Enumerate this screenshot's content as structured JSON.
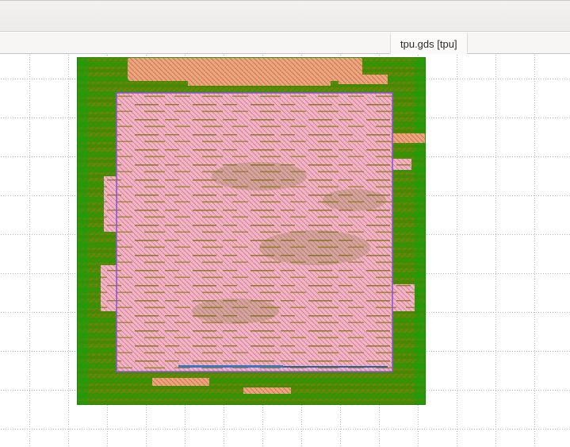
{
  "app": {
    "tab_label": "tpu.gds [tpu]"
  },
  "canvas": {
    "background": "#ffffff",
    "grid_color": "#b9b9b9",
    "die": {
      "colors": {
        "green_hatch": "#12a108",
        "olive_rows": "#7c7c08",
        "pink_region": "#f7b3c3",
        "pink_hatch": "#c2889a",
        "salmon_region": "#eda57f",
        "purple_boundary": "#8d55d8",
        "blue_trace": "#3a76c4",
        "die_outline": "#0a8a00"
      }
    }
  }
}
